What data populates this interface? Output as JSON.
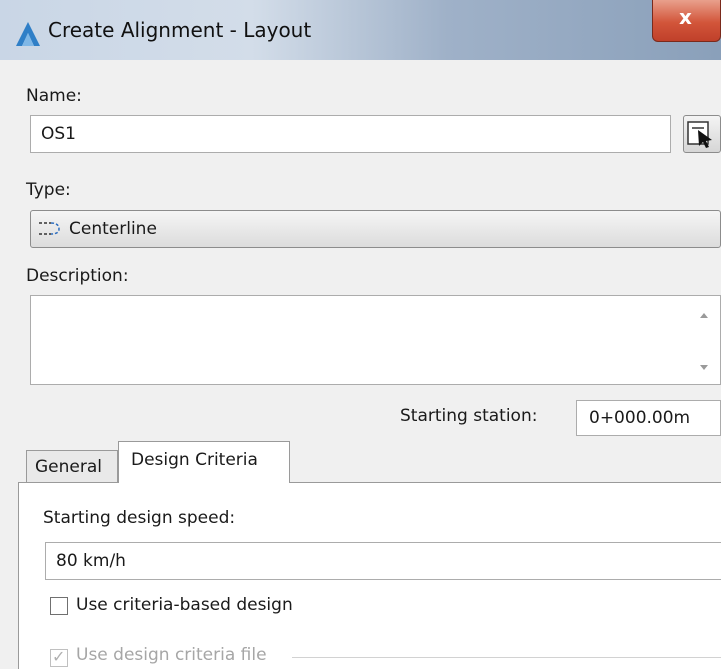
{
  "window": {
    "title": "Create Alignment - Layout",
    "close_symbol": "x",
    "app_icon": "civil3d-app-icon"
  },
  "form": {
    "name_label": "Name:",
    "name_value": "OS1",
    "pick_button_icon": "pick-from-drawing-icon",
    "type_label": "Type:",
    "type_value": "Centerline",
    "type_icon": "centerline-alignment-icon",
    "description_label": "Description:",
    "description_value": "",
    "starting_station_label": "Starting station:",
    "starting_station_value": "0+000.00m"
  },
  "tabs": [
    {
      "label": "General",
      "active": false
    },
    {
      "label": "Design Criteria",
      "active": true
    }
  ],
  "design_criteria": {
    "starting_speed_label": "Starting design speed:",
    "starting_speed_value": "80 km/h",
    "criteria_based_label": "Use criteria-based design",
    "criteria_based_checked": false,
    "criteria_file_label": "Use design criteria file",
    "criteria_file_checked": true,
    "criteria_file_enabled": false
  },
  "colors": {
    "close_button": "#d2553a",
    "dialog_background": "#f0f0f0"
  }
}
